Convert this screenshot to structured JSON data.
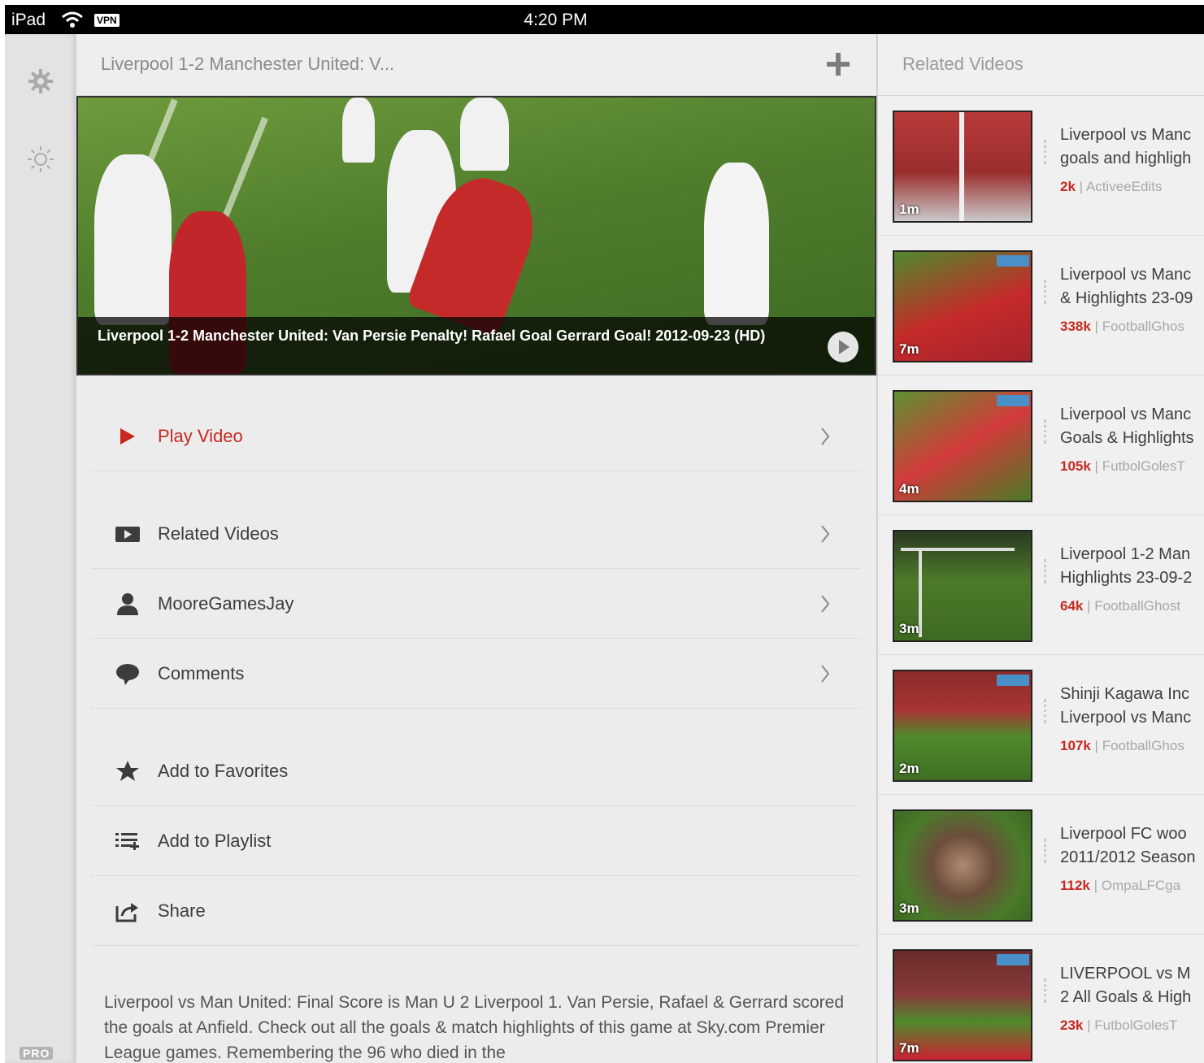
{
  "status_bar": {
    "carrier": "iPad",
    "vpn": "VPN",
    "time": "4:20 PM"
  },
  "rail": {
    "settings_icon": "gear-icon",
    "brightness_icon": "sun-icon",
    "badge": "PRO"
  },
  "center": {
    "title": "Liverpool 1-2 Manchester United: V...",
    "video_caption": "Liverpool 1-2 Manchester United: Van Persie Penalty! Rafael Goal Gerrard Goal! 2012-09-23 (HD)",
    "menu": [
      {
        "label": "Play Video",
        "icon": "play-icon",
        "accent": true
      },
      {
        "label": "Related Videos",
        "icon": "video-icon"
      },
      {
        "label": "MooreGamesJay",
        "icon": "user-icon"
      },
      {
        "label": "Comments",
        "icon": "comment-icon"
      },
      {
        "label": "Add to Favorites",
        "icon": "star-icon"
      },
      {
        "label": "Add to Playlist",
        "icon": "playlist-icon"
      },
      {
        "label": "Share",
        "icon": "share-icon"
      }
    ],
    "description": "Liverpool vs Man United: Final Score is Man U 2 Liverpool 1. Van Persie, Rafael & Gerrard scored the goals at Anfield. Check out all the goals & match highlights of this game at Sky.com Premier League games. Remembering the 96 who died in the"
  },
  "right": {
    "title": "Related Videos",
    "items": [
      {
        "line1": "Liverpool vs Manc",
        "line2": "goals and highligh",
        "views": "2k",
        "channel": "ActiveeEdits",
        "duration": "1m"
      },
      {
        "line1": "Liverpool vs Manc",
        "line2": "& Highlights 23-09",
        "views": "338k",
        "channel": "FootballGhos",
        "duration": "7m"
      },
      {
        "line1": "Liverpool vs Manc",
        "line2": "Goals & Highlights",
        "views": "105k",
        "channel": "FutbolGolesT",
        "duration": "4m"
      },
      {
        "line1": "Liverpool 1-2 Man",
        "line2": "Highlights 23-09-2",
        "views": "64k",
        "channel": "FootballGhost",
        "duration": "3m"
      },
      {
        "line1": "Shinji Kagawa Inc",
        "line2": "Liverpool vs Manc",
        "views": "107k",
        "channel": "FootballGhos",
        "duration": "2m"
      },
      {
        "line1": "Liverpool FC woo",
        "line2": "2011/2012 Season",
        "views": "112k",
        "channel": "OmpaLFCga",
        "duration": "3m"
      },
      {
        "line1": "LIVERPOOL vs M",
        "line2": "2 All Goals & High",
        "views": "23k",
        "channel": "FutbolGolesT",
        "duration": "7m"
      }
    ]
  },
  "colors": {
    "accent": "#c7291f",
    "panel": "#ececec",
    "text": "#3c3c3c"
  }
}
